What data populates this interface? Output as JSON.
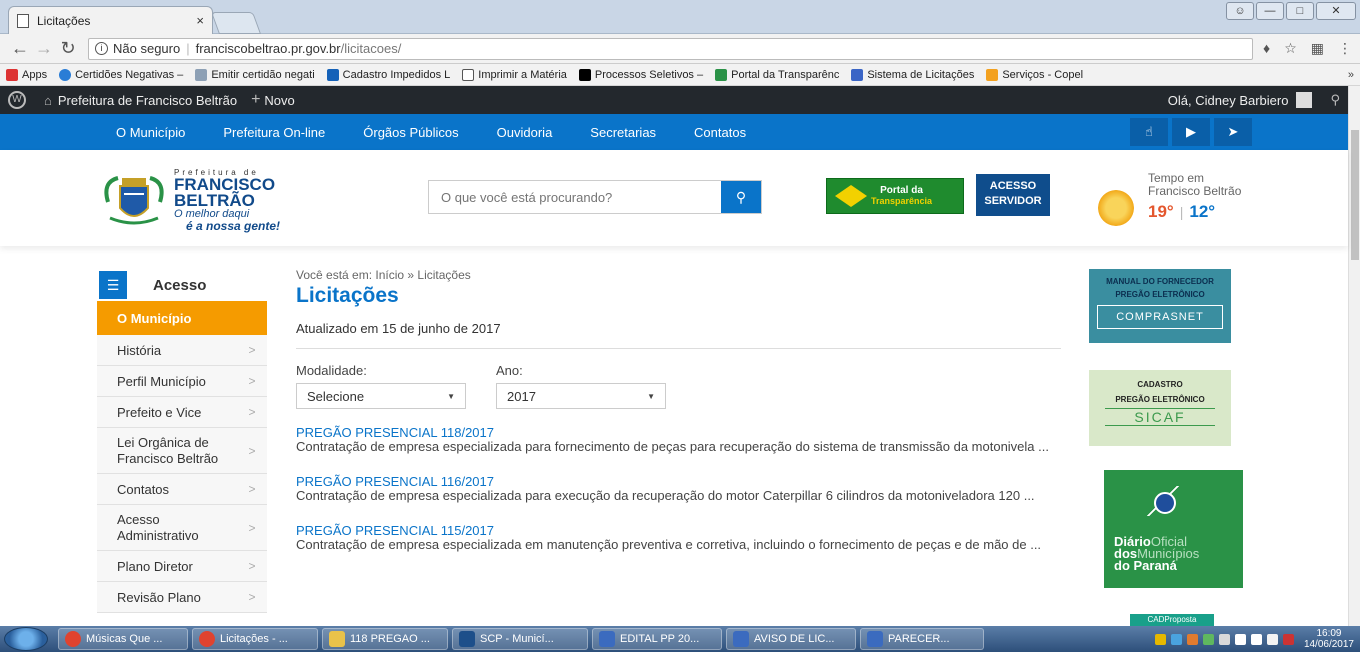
{
  "browser": {
    "tab_title": "Licitações",
    "tab_close": "×",
    "url_security": "Não seguro",
    "url_domain": "franciscobeltrao.pr.gov.br",
    "url_path": "/licitacoes/",
    "bookmarks": [
      {
        "label": "Apps",
        "color": "#d33"
      },
      {
        "label": "Certidões Negativas –",
        "color": "#2a7dd6"
      },
      {
        "label": "Emitir certidão negati",
        "color": "#8da0b5"
      },
      {
        "label": "Cadastro Impedidos L",
        "color": "#1461b8"
      },
      {
        "label": "Imprimir a Matéria",
        "color": "#ffffff"
      },
      {
        "label": "Processos Seletivos –",
        "color": "#000000"
      },
      {
        "label": "Portal da Transparênc",
        "color": "#2a9247"
      },
      {
        "label": "Sistema de Licitações",
        "color": "#3a65c6"
      },
      {
        "label": "Serviços - Copel",
        "color": "#f3a11f"
      }
    ],
    "bookmarks_more": "»"
  },
  "wp_admin_bar": {
    "site_name": "Prefeitura de Francisco Beltrão",
    "new_label": "Novo",
    "greeting": "Olá, Cidney Barbiero"
  },
  "site_nav": {
    "items": [
      "O Município",
      "Prefeitura On-line",
      "Órgãos Públicos",
      "Ouvidoria",
      "Secretarias",
      "Contatos"
    ],
    "social": [
      "like-icon",
      "play-icon",
      "twitter-icon"
    ]
  },
  "header": {
    "logo_small": "Prefeitura de",
    "logo_line1": "FRANCISCO",
    "logo_line2": "BELTRÃO",
    "logo_slogan1": "O melhor daqui",
    "logo_slogan2": "é a nossa gente!",
    "search_placeholder": "O que você está procurando?",
    "portal_line1": "Portal da",
    "portal_line2": "Transparência",
    "access_line1": "ACESSO",
    "access_line2": "SERVIDOR",
    "weather_title": "Tempo em Francisco Beltrão",
    "temp_max": "19°",
    "temp_sep": "|",
    "temp_min": "12°"
  },
  "sidebar": {
    "title": "Acesso",
    "active": "O Município",
    "items": [
      "História",
      "Perfil Município",
      "Prefeito e Vice",
      "Lei Orgânica de Francisco Beltrão",
      "Contatos",
      "Acesso Administrativo",
      "Plano Diretor",
      "Revisão Plano"
    ]
  },
  "main": {
    "breadcrumb": "Você está em: Início » Licitações",
    "title": "Licitações",
    "updated": "Atualizado em 15 de junho de 2017",
    "filter_modalidade_label": "Modalidade:",
    "filter_modalidade_value": "Selecione",
    "filter_ano_label": "Ano:",
    "filter_ano_value": "2017",
    "licitacoes": [
      {
        "title": "PREGÃO PRESENCIAL 118/2017",
        "desc": "Contratação de empresa especializada para fornecimento de peças para recuperação do sistema de transmissão da motonivela ..."
      },
      {
        "title": "PREGÃO PRESENCIAL 116/2017",
        "desc": "Contratação de empresa especializada para execução da recuperação do motor Caterpillar 6 cilindros da motoniveladora 120 ..."
      },
      {
        "title": "PREGÃO PRESENCIAL 115/2017",
        "desc": "Contratação de empresa especializada em manutenção preventiva e corretiva, incluindo o fornecimento de peças e de mão de ..."
      }
    ]
  },
  "banners": {
    "manual_l1": "MANUAL DO FORNECEDOR",
    "manual_l2": "PREGÃO ELETRÔNICO",
    "manual_l3": "COMPRASNET",
    "cadastro_l1": "CADASTRO",
    "cadastro_l2": "PREGÃO ELETRÔNICO",
    "cadastro_l3": "SICAF",
    "diario_l1": "Diário",
    "diario_l1b": "Oficial",
    "diario_l2": "dos",
    "diario_l2b": "Municípios",
    "diario_l3": "do Paraná",
    "cad_proposta": "CADProposta"
  },
  "taskbar": {
    "items": [
      {
        "label": "Músicas Que ...",
        "color": "#e0432f"
      },
      {
        "label": "Licitações - ...",
        "color": "#e0432f"
      },
      {
        "label": "118 PREGAO ...",
        "color": "#e9c24a"
      },
      {
        "label": "SCP - Municí...",
        "color": "#1d4f8a"
      },
      {
        "label": "EDITAL PP 20...",
        "color": "#3b6bbf"
      },
      {
        "label": "AVISO DE LIC...",
        "color": "#3b6bbf"
      },
      {
        "label": "PARECER...",
        "color": "#3b6bbf"
      }
    ],
    "time": "16:09",
    "date": "14/06/2017"
  }
}
